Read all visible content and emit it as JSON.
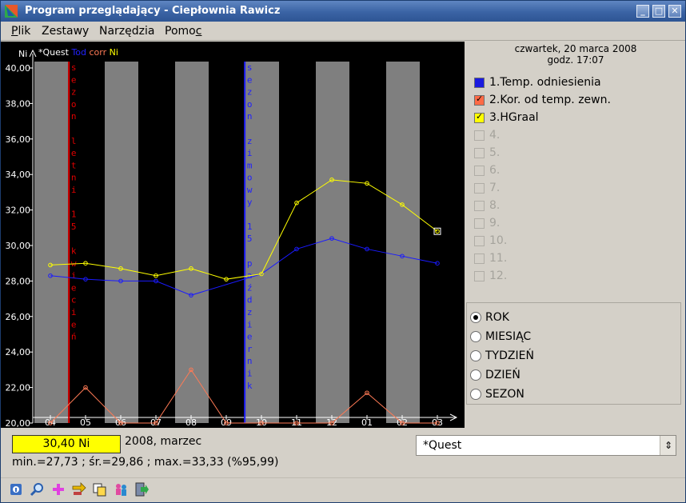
{
  "window": {
    "title": "Program przeglądający - Ciepłownia Rawicz",
    "minimize": "_",
    "maximize": "□",
    "close": "✕"
  },
  "menu": [
    {
      "pre": "",
      "u": "P",
      "post": "lik"
    },
    {
      "pre": "Zestawy",
      "u": "",
      "post": ""
    },
    {
      "pre": "Narzędzia",
      "u": "",
      "post": ""
    },
    {
      "pre": "Pomo",
      "u": "c",
      "post": ""
    }
  ],
  "chart": {
    "unit_label": "Ni",
    "legend_parts": [
      {
        "text": "*Quest",
        "color": "#ffffff"
      },
      {
        "text": "Tod",
        "color": "#2222ff"
      },
      {
        "text": "corr",
        "color": "#ff7a55"
      },
      {
        "text": "Ni",
        "color": "#ffff00"
      }
    ],
    "summer_label": "sezon letni 15 kwiecień",
    "winter_label": "sezon zimowy 15 październik"
  },
  "chart_data": {
    "type": "line",
    "categories": [
      "04",
      "05",
      "06",
      "07",
      "08",
      "09",
      "10",
      "11",
      "12",
      "01",
      "02",
      "03"
    ],
    "y_ticks": [
      "40,00",
      "38,00",
      "36,00",
      "34,00",
      "32,00",
      "30,00",
      "28,00",
      "26,00",
      "24,00",
      "22,00",
      "20,00"
    ],
    "ylim": [
      20,
      40
    ],
    "series": [
      {
        "color": "#1a1aff",
        "values": [
          28.3,
          28.1,
          28.0,
          28.0,
          27.2,
          null,
          28.4,
          29.8,
          30.4,
          29.8,
          29.4,
          29.0
        ]
      },
      {
        "color": "#ff7a55",
        "values": [
          20.0,
          22.0,
          20.0,
          20.0,
          23.0,
          20.0,
          20.0,
          20.0,
          20.0,
          21.7,
          20.0,
          20.0
        ]
      },
      {
        "color": "#ffff00",
        "values": [
          28.9,
          29.0,
          28.7,
          28.3,
          28.7,
          28.1,
          28.4,
          32.4,
          33.7,
          33.5,
          32.3,
          30.8
        ]
      }
    ],
    "shaded_columns": [
      0,
      2,
      4,
      6,
      8,
      10
    ],
    "season_markers": [
      {
        "at": 0.55,
        "color": "#e00000"
      },
      {
        "at": 5.55,
        "color": "#2020ff"
      }
    ],
    "colors": {
      "background": "#000000",
      "shade": "#7f7f7f",
      "axis": "#ffffff"
    }
  },
  "info": {
    "date": "czwartek, 20 marca 2008",
    "time": "godz. 17:07"
  },
  "series_list": [
    {
      "label": "1.Temp. odniesienia",
      "color": "#1a1adf",
      "checked": true,
      "enabled": true
    },
    {
      "label": "2.Kor. od temp. zewn.",
      "color": "#ff6a45",
      "checked": true,
      "enabled": true
    },
    {
      "label": "3.HGraal",
      "color": "#ffff00",
      "checked": true,
      "enabled": true
    },
    {
      "label": "4.",
      "enabled": false
    },
    {
      "label": "5.",
      "enabled": false
    },
    {
      "label": "6.",
      "enabled": false
    },
    {
      "label": "7.",
      "enabled": false
    },
    {
      "label": "8.",
      "enabled": false
    },
    {
      "label": "9.",
      "enabled": false
    },
    {
      "label": "10.",
      "enabled": false
    },
    {
      "label": "11.",
      "enabled": false
    },
    {
      "label": "12.",
      "enabled": false
    }
  ],
  "period_options": [
    {
      "label": "ROK",
      "selected": true
    },
    {
      "label": "MIESIĄC",
      "selected": false
    },
    {
      "label": "TYDZIEŃ",
      "selected": false
    },
    {
      "label": "DZIEŃ",
      "selected": false
    },
    {
      "label": "SEZON",
      "selected": false
    }
  ],
  "status": {
    "value": "30,40 Ni",
    "period": "2008, marzec",
    "stats": "min.=27,73 ; śr.=29,86 ; max.=33,33  (%95,99)"
  },
  "dataset_select": {
    "value": "*Quest",
    "arrow": "⇕"
  },
  "toolbar_icons": [
    "help-icon",
    "zoom-icon",
    "add-icon",
    "swap-icon",
    "copy-icon",
    "refresh-icon",
    "exit-icon"
  ]
}
